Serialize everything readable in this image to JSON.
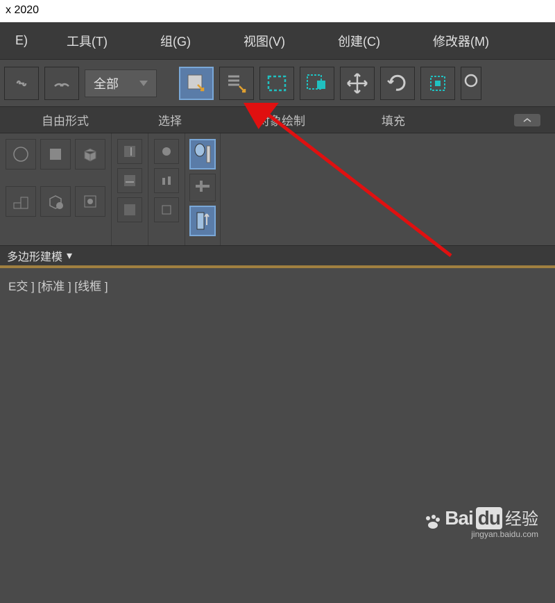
{
  "title": "x 2020",
  "menu": {
    "edit": "E)",
    "tools": "工具(T)",
    "group": "组(G)",
    "view": "视图(V)",
    "create": "创建(C)",
    "modifiers": "修改器(M)"
  },
  "toolbar": {
    "filter_label": "全部"
  },
  "tabs": {
    "freeform": "自由形式",
    "selection": "选择",
    "object_paint": "对象绘制",
    "populate": "填充"
  },
  "ribbon": {
    "group_label": "多边形建模",
    "dropdown_arrow": "▾"
  },
  "viewport": {
    "label": "E交 ] [标准 ] [线框 ]"
  },
  "watermark": {
    "brand_bai": "Bai",
    "brand_du": "du",
    "suffix": "经验",
    "url": "jingyan.baidu.com"
  },
  "colors": {
    "accent": "#20c0c0",
    "highlight": "#5a7ca8"
  }
}
